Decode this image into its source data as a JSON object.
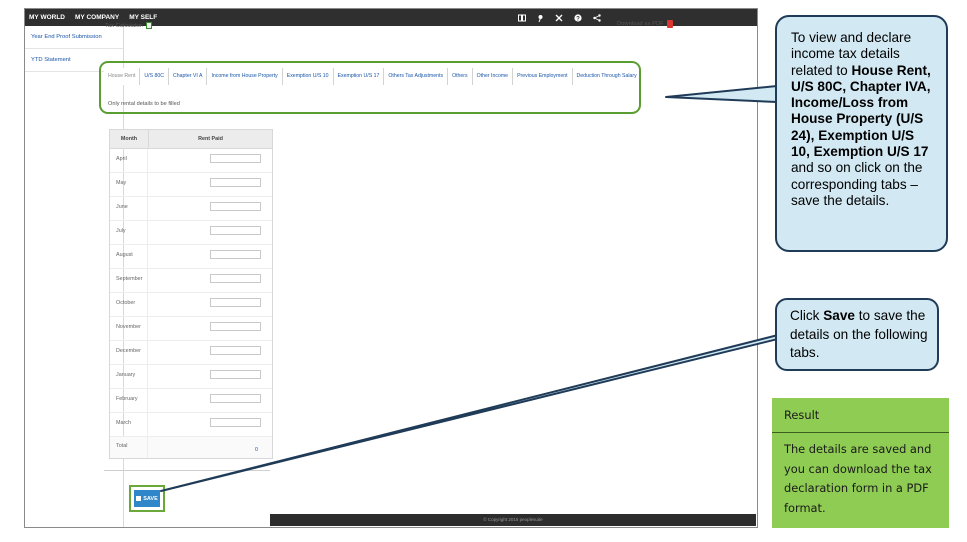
{
  "topnav": [
    "MY WORLD",
    "MY COMPANY",
    "MY SELF"
  ],
  "sidebar": {
    "items": [
      "Year End Proof Submission",
      "YTD Statement"
    ]
  },
  "header": {
    "tax_calculator": "Tax Calculator:",
    "download_pdf": "Download as PDF"
  },
  "tabs": [
    "House Rent",
    "U/S 80C",
    "Chapter VI A",
    "Income from House Property",
    "Exemption U/S 10",
    "Exemption U/S 17",
    "Others Tax Adjustments",
    "Others",
    "Other Income",
    "Previous Employment",
    "Deduction Through Salary"
  ],
  "note": "Only rental details to be filled",
  "rent_table": {
    "headers": {
      "month": "Month",
      "rent": "Rent Paid"
    },
    "months": [
      "April",
      "May",
      "June",
      "July",
      "August",
      "September",
      "October",
      "November",
      "December",
      "January",
      "February",
      "March"
    ],
    "total_label": "Total",
    "total_value": "0"
  },
  "save_label": "SAVE",
  "footer": "© Copyright 2015  peoplesuite",
  "callout1": {
    "t1": "To view and declare income tax details related to ",
    "b1": "House Rent, U/S 80C, Chapter IVA, Income/Loss from House Property (U/S 24), Exemption U/S 10, Exemption U/S 17",
    "t2": " and so on click on the corresponding tabs – save the details."
  },
  "callout2": {
    "t1": "Click ",
    "b1": "Save",
    "t2": " to save the details on the following tabs."
  },
  "result": {
    "title": "Result",
    "body": "The details are saved and you can download the tax declaration form in a PDF format."
  },
  "colors": {
    "accent_blue": "#2f86c9",
    "highlight_green": "#6aa83a",
    "result_green": "#8fcc53",
    "callout_fill": "#d2e9f3",
    "callout_border": "#1f3b57",
    "topbar": "#2f2f2f"
  },
  "icons": [
    "book-icon",
    "pin-icon",
    "tools-icon",
    "help-icon",
    "share-icon",
    "calculator-icon",
    "pdf-icon",
    "save-disk-icon"
  ]
}
